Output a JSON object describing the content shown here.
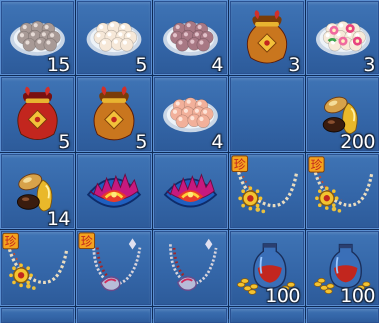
{
  "inventory": {
    "slots": [
      {
        "item": "plate-grey-dumplings-icon",
        "qty": "15"
      },
      {
        "item": "plate-white-dumplings-icon",
        "qty": "5"
      },
      {
        "item": "plate-purple-dumplings-icon",
        "qty": "4"
      },
      {
        "item": "gold-lucky-pouch-icon",
        "qty": "3"
      },
      {
        "item": "plate-pink-flower-dumplings-icon",
        "qty": "3"
      },
      {
        "item": "red-lucky-pouch-icon",
        "qty": "5"
      },
      {
        "item": "gold-lucky-pouch-icon",
        "qty": "5"
      },
      {
        "item": "plate-peach-dumplings-icon",
        "qty": "4"
      },
      {
        "item": "empty-slot",
        "qty": ""
      },
      {
        "item": "gemstones-icon",
        "qty": "200"
      },
      {
        "item": "gemstones-icon",
        "qty": "14"
      },
      {
        "item": "flame-crown-icon",
        "qty": ""
      },
      {
        "item": "flame-crown-icon",
        "qty": ""
      },
      {
        "item": "treasure-necklace-icon",
        "qty": ""
      },
      {
        "item": "treasure-necklace-icon",
        "qty": ""
      },
      {
        "item": "treasure-necklace-icon",
        "qty": ""
      },
      {
        "item": "treasure-bead-necklace-icon",
        "qty": ""
      },
      {
        "item": "bead-necklace-icon",
        "qty": ""
      },
      {
        "item": "vase-with-gold-icon",
        "qty": "100"
      },
      {
        "item": "vase-with-gold-icon",
        "qty": "100"
      },
      {
        "item": "empty-slot",
        "qty": ""
      },
      {
        "item": "empty-slot",
        "qty": ""
      },
      {
        "item": "empty-slot",
        "qty": ""
      },
      {
        "item": "empty-slot",
        "qty": ""
      },
      {
        "item": "empty-slot",
        "qty": ""
      }
    ],
    "treasure_badge": "珍",
    "colors": {
      "slot_bg": "#3a6db0",
      "slot_border": "#5b8fd1",
      "grid_line": "#0f2a55",
      "qty_text": "#ffffff"
    }
  }
}
